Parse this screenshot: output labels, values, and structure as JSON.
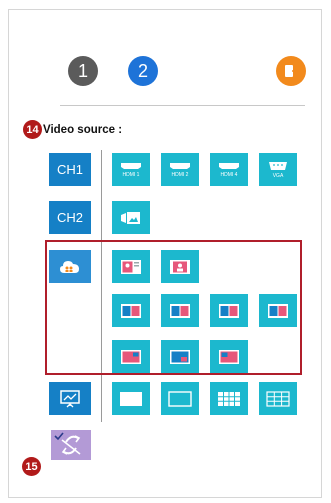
{
  "top_buttons": [
    "1",
    "2"
  ],
  "callouts": {
    "video_source": "14",
    "bottom": "15"
  },
  "video_source_label": "Video source :",
  "channels": [
    "CH1",
    "CH2"
  ],
  "ch1_sources": [
    "HDMI 1",
    "HDMI 2",
    "HDMI 4",
    "VGA"
  ],
  "colors": {
    "tile": "#1cb8ce",
    "channel": "#1580c6",
    "highlight": "#b01e2b"
  }
}
